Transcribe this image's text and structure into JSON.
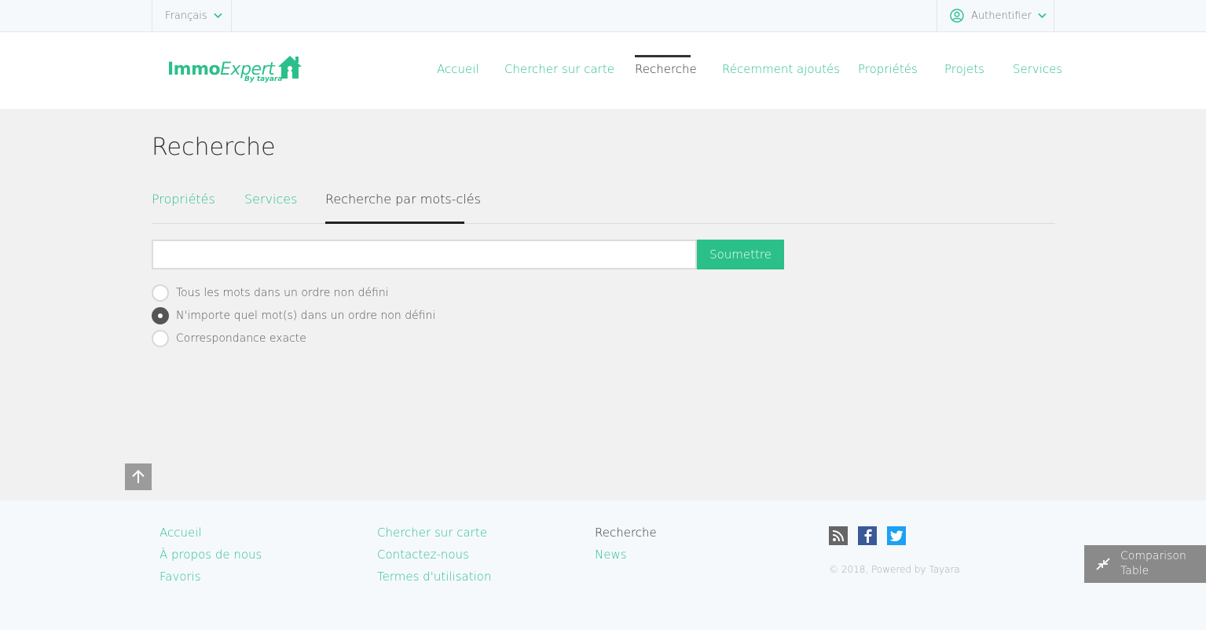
{
  "topbar": {
    "language": "Français",
    "auth_label": "Authentifier"
  },
  "logo": {
    "immo": "Immo",
    "expert": "Expert",
    "by": "By tayara"
  },
  "nav": {
    "items": [
      {
        "label": "Accueil"
      },
      {
        "label": "Chercher sur carte"
      },
      {
        "label": "Recherche"
      },
      {
        "label": "Récemment ajoutés"
      },
      {
        "label": "Propriétés"
      },
      {
        "label": "Projets"
      },
      {
        "label": "Services"
      }
    ],
    "active": "Recherche"
  },
  "main": {
    "title": "Recherche",
    "tabs": [
      {
        "label": "Propriétés"
      },
      {
        "label": "Services"
      },
      {
        "label": "Recherche par mots-clés"
      }
    ],
    "active_tab": "Recherche par mots-clés",
    "search": {
      "value": "",
      "placeholder": ""
    },
    "submit_label": "Soumettre",
    "options": [
      {
        "label": "Tous les mots dans un ordre non défini",
        "checked": false
      },
      {
        "label": "N'importe quel mot(s) dans un ordre non défini",
        "checked": true
      },
      {
        "label": "Correspondance exacte",
        "checked": false
      }
    ]
  },
  "footer": {
    "col1": [
      "Accueil",
      "À propos de nous",
      "Favoris"
    ],
    "col2": [
      "Chercher sur carte",
      "Contactez-nous",
      "Termes d'utilisation"
    ],
    "col3": [
      "Recherche",
      "News"
    ],
    "copyright": "© 2018, Powered by Tayara"
  },
  "comparison": {
    "label": "Comparison Table"
  },
  "colors": {
    "accent": "#2bbf8a",
    "background": "#f1f1f1",
    "topbar": "#f5f9fc",
    "facebook": "#3b5998",
    "twitter": "#1da1f2"
  }
}
